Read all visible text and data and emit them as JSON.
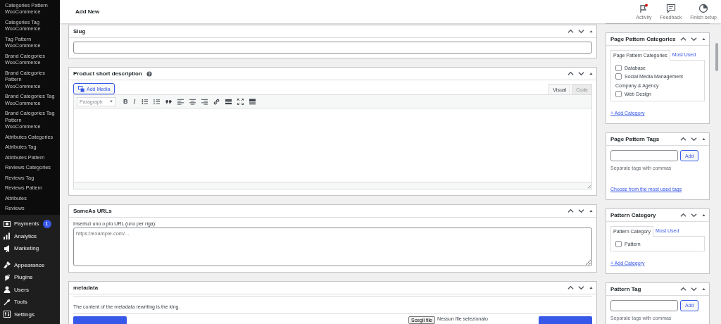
{
  "sidebar": {
    "submenu": [
      "Categories Pattern WooCommerce",
      "Categories Tag WooCommerce",
      "Tag Pattern WooCommerce",
      "Brand Categories WooCommerce",
      "Brand Categories Pattern WooCommerce",
      "Brand Categories Tag WooCommerce",
      "Brand Categories Tag Pattern WooCommerce",
      "Attributes Categories",
      "Attributes Tag",
      "Attributes Pattern",
      "Reviews Categories",
      "Reviews Tag",
      "Reviews Pattern",
      "Attributes",
      "Reviews"
    ],
    "menu": [
      [
        {
          "label": "Payments",
          "kind": "payments",
          "badge": "1"
        },
        {
          "label": "Analytics",
          "kind": "analytics"
        },
        {
          "label": "Marketing",
          "kind": "marketing"
        }
      ],
      [
        {
          "label": "Appearance",
          "kind": "appearance"
        },
        {
          "label": "Plugins",
          "kind": "plugins"
        },
        {
          "label": "Users",
          "kind": "users"
        },
        {
          "label": "Tools",
          "kind": "tools"
        },
        {
          "label": "Settings",
          "kind": "settings"
        }
      ]
    ]
  },
  "header": {
    "title": "Add New",
    "actions": [
      {
        "label": "Activity",
        "kind": "activity"
      },
      {
        "label": "Feedback",
        "kind": "feedback"
      },
      {
        "label": "Finish setup",
        "kind": "setup"
      }
    ]
  },
  "main_panels": [
    {
      "kind": "slug",
      "title": "Slug"
    },
    {
      "kind": "editor",
      "title": "Product short description",
      "add_media": "Add Media",
      "tabs": [
        {
          "label": "Visual",
          "selected": true
        },
        {
          "label": "Code",
          "selected": false
        }
      ],
      "format": "Paragraph",
      "toolbar": [
        {
          "kind": "bold",
          "glyph": "B"
        },
        {
          "kind": "italic",
          "glyph": "I"
        },
        {
          "kind": "bullets"
        },
        {
          "kind": "numbers"
        },
        {
          "kind": "quote"
        },
        {
          "kind": "align-left"
        },
        {
          "kind": "align-center"
        },
        {
          "kind": "align-right"
        },
        {
          "kind": "link"
        },
        {
          "kind": "more"
        },
        {
          "kind": "fullscreen"
        },
        {
          "kind": "kitchen"
        }
      ]
    },
    {
      "kind": "urls",
      "title": "SameAs URLs",
      "label": "Inserisci uno o più URL (uno per riga):",
      "placeholder": "https://example.com/..."
    },
    {
      "kind": "metadata",
      "title": "metadata",
      "text": "The content of the metadata rewriting is the king.",
      "file_button": "Scegli file",
      "file_status": "Nessun file selezionato"
    }
  ],
  "side_panels": [
    {
      "kind": "categories",
      "title": "Page Pattern Categories",
      "tabs": [
        {
          "label": "Page Pattern Categories",
          "selected": true
        },
        {
          "label": "Most Used",
          "selected": false
        }
      ],
      "items": [
        {
          "kind": "checkbox",
          "label": "Database",
          "checked": false
        },
        {
          "kind": "checkbox",
          "label": "Social Media Management",
          "checked": false
        },
        {
          "kind": "heading",
          "label": "Company & Agency"
        },
        {
          "kind": "checkbox",
          "label": "Web Design",
          "checked": false
        }
      ],
      "link": "+ Add Category"
    },
    {
      "kind": "tags",
      "title": "Page Pattern Tags",
      "button": "Add",
      "hint": "Separate tags with commas",
      "link": "Choose from the most used tags"
    },
    {
      "kind": "categories",
      "title": "Pattern Category",
      "tabs": [
        {
          "label": "Pattern Category",
          "selected": true
        },
        {
          "label": "Most Used",
          "selected": false
        }
      ],
      "items": [
        {
          "kind": "checkbox",
          "label": "Pattern",
          "checked": false
        }
      ],
      "link": "+ Add Category"
    },
    {
      "kind": "tags",
      "title": "Pattern Tag",
      "button": "Add",
      "hint": "Separate tags with commas"
    }
  ]
}
